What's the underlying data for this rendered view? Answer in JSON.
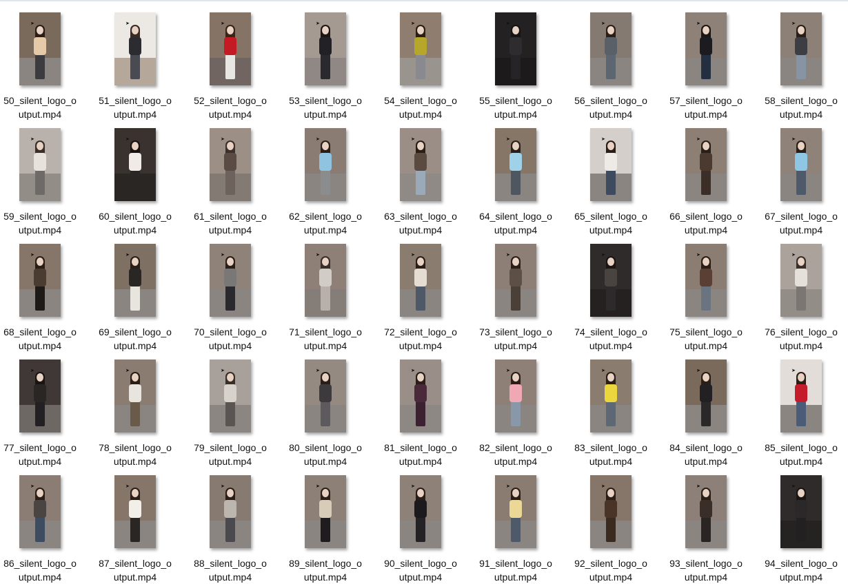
{
  "files": [
    {
      "line1": "50_silent_logo_o",
      "line2": "utput.mp4",
      "wall": "#7a6a5c",
      "floor": "#8a8580",
      "top": "#e6c9a6",
      "legs": "#3c3c40",
      "hair": "#2a1d18"
    },
    {
      "line1": "51_silent_logo_o",
      "line2": "utput.mp4",
      "wall": "#ece8e4",
      "floor": "#b5a89a",
      "top": "#2c2c30",
      "legs": "#4a4a52",
      "hair": "#3a2a22"
    },
    {
      "line1": "52_silent_logo_o",
      "line2": "utput.mp4",
      "wall": "#857466",
      "floor": "#706560",
      "top": "#c41a24",
      "legs": "#e8e6e2",
      "hair": "#3a2418"
    },
    {
      "line1": "53_silent_logo_o",
      "line2": "utput.mp4",
      "wall": "#a59a92",
      "floor": "#8f8884",
      "top": "#222226",
      "legs": "#2a2a2e",
      "hair": "#1e1612"
    },
    {
      "line1": "54_silent_logo_o",
      "line2": "utput.mp4",
      "wall": "#8f7e70",
      "floor": "#9a948e",
      "top": "#b6a62a",
      "legs": "#888a90",
      "hair": "#2a1e16"
    },
    {
      "line1": "55_silent_logo_o",
      "line2": "utput.mp4",
      "wall": "#232122",
      "floor": "#1c1a1b",
      "top": "#2e2c2e",
      "legs": "#262426",
      "hair": "#151314"
    },
    {
      "line1": "56_silent_logo_o",
      "line2": "utput.mp4",
      "wall": "#857a72",
      "floor": "#8a8580",
      "top": "#596068",
      "legs": "#5c6670",
      "hair": "#2a1e16"
    },
    {
      "line1": "57_silent_logo_o",
      "line2": "utput.mp4",
      "wall": "#8e8178",
      "floor": "#8a8580",
      "top": "#1c1c20",
      "legs": "#243042",
      "hair": "#1e1612"
    },
    {
      "line1": "58_silent_logo_o",
      "line2": "utput.mp4",
      "wall": "#8d8076",
      "floor": "#8a8580",
      "top": "#3c3e44",
      "legs": "#8694a4",
      "hair": "#2a1e16"
    },
    {
      "line1": "59_silent_logo_o",
      "line2": "utput.mp4",
      "wall": "#b9b2ac",
      "floor": "#938d88",
      "top": "#e8e2dc",
      "legs": "#6e6a68",
      "hair": "#3a2e28"
    },
    {
      "line1": "60_silent_logo_o",
      "line2": "utput.mp4",
      "wall": "#39322f",
      "floor": "#2a2624",
      "top": "#f0ebe6",
      "legs": "#2a2624",
      "hair": "#1a1210"
    },
    {
      "line1": "61_silent_logo_o",
      "line2": "utput.mp4",
      "wall": "#9b8f86",
      "floor": "#847a74",
      "top": "#5a4c44",
      "legs": "#6e625c",
      "hair": "#3c302a"
    },
    {
      "line1": "62_silent_logo_o",
      "line2": "utput.mp4",
      "wall": "#8a7c72",
      "floor": "#8a8580",
      "top": "#8fc3e0",
      "legs": "#8a8c8e",
      "hair": "#2a1e16"
    },
    {
      "line1": "63_silent_logo_o",
      "line2": "utput.mp4",
      "wall": "#9a8e86",
      "floor": "#8f8a86",
      "top": "#5a4a40",
      "legs": "#9aaab8",
      "hair": "#2a1e16"
    },
    {
      "line1": "64_silent_logo_o",
      "line2": "utput.mp4",
      "wall": "#857668",
      "floor": "#8a8580",
      "top": "#9fd1e8",
      "legs": "#4e5660",
      "hair": "#2a1e16"
    },
    {
      "line1": "65_silent_logo_o",
      "line2": "utput.mp4",
      "wall": "#d4cfca",
      "floor": "#8a8580",
      "top": "#eeeae6",
      "legs": "#3e4a5e",
      "hair": "#2a1e16"
    },
    {
      "line1": "66_silent_logo_o",
      "line2": "utput.mp4",
      "wall": "#8d7f74",
      "floor": "#8a8580",
      "top": "#4a3a30",
      "legs": "#3a2e26",
      "hair": "#2a1e16"
    },
    {
      "line1": "67_silent_logo_o",
      "line2": "utput.mp4",
      "wall": "#8f8279",
      "floor": "#8a8580",
      "top": "#8fc6e4",
      "legs": "#4e5a6a",
      "hair": "#2a1e16"
    },
    {
      "line1": "68_silent_logo_o",
      "line2": "utput.mp4",
      "wall": "#857669",
      "floor": "#8a8580",
      "top": "#4b3c32",
      "legs": "#1e1a18",
      "hair": "#2a1e16"
    },
    {
      "line1": "69_silent_logo_o",
      "line2": "utput.mp4",
      "wall": "#7f7064",
      "floor": "#8a8580",
      "top": "#2a2624",
      "legs": "#e8e4de",
      "hair": "#2a1e16"
    },
    {
      "line1": "70_silent_logo_o",
      "line2": "utput.mp4",
      "wall": "#8f8279",
      "floor": "#8a8580",
      "top": "#7a7876",
      "legs": "#2a2a2e",
      "hair": "#2a1e16"
    },
    {
      "line1": "71_silent_logo_o",
      "line2": "utput.mp4",
      "wall": "#8e8077",
      "floor": "#857d78",
      "top": "#d2ccc6",
      "legs": "#b8b0aa",
      "hair": "#3a2e28"
    },
    {
      "line1": "72_silent_logo_o",
      "line2": "utput.mp4",
      "wall": "#8b7c70",
      "floor": "#8a8580",
      "top": "#e6ddd2",
      "legs": "#4e5866",
      "hair": "#2a1e16"
    },
    {
      "line1": "73_silent_logo_o",
      "line2": "utput.mp4",
      "wall": "#8d7f76",
      "floor": "#8a8580",
      "top": "#5c5046",
      "legs": "#4a4038",
      "hair": "#2a1e16"
    },
    {
      "line1": "74_silent_logo_o",
      "line2": "utput.mp4",
      "wall": "#2e2b2a",
      "floor": "#242120",
      "top": "#4a4440",
      "legs": "#2c2a2a",
      "hair": "#1a1412"
    },
    {
      "line1": "75_silent_logo_o",
      "line2": "utput.mp4",
      "wall": "#8c7d72",
      "floor": "#8a8580",
      "top": "#5a4034",
      "legs": "#6a7480",
      "hair": "#2a1e16"
    },
    {
      "line1": "76_silent_logo_o",
      "line2": "utput.mp4",
      "wall": "#aba29b",
      "floor": "#938d88",
      "top": "#e6e0da",
      "legs": "#7c7672",
      "hair": "#3a2e28"
    },
    {
      "line1": "77_silent_logo_o",
      "line2": "utput.mp4",
      "wall": "#3f3836",
      "floor": "#6e6864",
      "top": "#2a2624",
      "legs": "#222022",
      "hair": "#1a1412"
    },
    {
      "line1": "78_silent_logo_o",
      "line2": "utput.mp4",
      "wall": "#8a7c70",
      "floor": "#8a8580",
      "top": "#e8e4de",
      "legs": "#6a5a4a",
      "hair": "#2a1e16"
    },
    {
      "line1": "79_silent_logo_o",
      "line2": "utput.mp4",
      "wall": "#a8a09a",
      "floor": "#8c8682",
      "top": "#d8d2cc",
      "legs": "#5a5452",
      "hair": "#3a2e28"
    },
    {
      "line1": "80_silent_logo_o",
      "line2": "utput.mp4",
      "wall": "#958a82",
      "floor": "#8a8580",
      "top": "#3c3a3c",
      "legs": "#5c5a5c",
      "hair": "#2a1e16"
    },
    {
      "line1": "81_silent_logo_o",
      "line2": "utput.mp4",
      "wall": "#9a8f88",
      "floor": "#8d8884",
      "top": "#4a2a3a",
      "legs": "#3c2230",
      "hair": "#2a1e16"
    },
    {
      "line1": "82_silent_logo_o",
      "line2": "utput.mp4",
      "wall": "#8e8076",
      "floor": "#8a8580",
      "top": "#f0a8b4",
      "legs": "#8898a8",
      "hair": "#2a1e16"
    },
    {
      "line1": "83_silent_logo_o",
      "line2": "utput.mp4",
      "wall": "#8b7c70",
      "floor": "#8a8580",
      "top": "#ecd63e",
      "legs": "#5e6874",
      "hair": "#2a1e16"
    },
    {
      "line1": "84_silent_logo_o",
      "line2": "utput.mp4",
      "wall": "#7a6a5c",
      "floor": "#8a8580",
      "top": "#222022",
      "legs": "#2a2828",
      "hair": "#2a1e16"
    },
    {
      "line1": "85_silent_logo_o",
      "line2": "utput.mp4",
      "wall": "#e2ddd8",
      "floor": "#8a8580",
      "top": "#c41c2a",
      "legs": "#4a5c78",
      "hair": "#2a1e16"
    },
    {
      "line1": "86_silent_logo_o",
      "line2": "utput.mp4",
      "wall": "#8b7d73",
      "floor": "#8a8580",
      "top": "#4a4442",
      "legs": "#3e4c62",
      "hair": "#2a1e16"
    },
    {
      "line1": "87_silent_logo_o",
      "line2": "utput.mp4",
      "wall": "#857669",
      "floor": "#8a8580",
      "top": "#f2eee8",
      "legs": "#2a2624",
      "hair": "#2a1e16"
    },
    {
      "line1": "88_silent_logo_o",
      "line2": "utput.mp4",
      "wall": "#877a70",
      "floor": "#8a8580",
      "top": "#bcb6ae",
      "legs": "#4a4a4e",
      "hair": "#2a1e16"
    },
    {
      "line1": "89_silent_logo_o",
      "line2": "utput.mp4",
      "wall": "#8d8076",
      "floor": "#8a8580",
      "top": "#d6ccb8",
      "legs": "#1e1c1e",
      "hair": "#2a1e16"
    },
    {
      "line1": "90_silent_logo_o",
      "line2": "utput.mp4",
      "wall": "#8e8178",
      "floor": "#8a8580",
      "top": "#1c1a1c",
      "legs": "#242224",
      "hair": "#2a1e16"
    },
    {
      "line1": "91_silent_logo_o",
      "line2": "utput.mp4",
      "wall": "#8a7c70",
      "floor": "#8a8580",
      "top": "#ecd896",
      "legs": "#4e5a6a",
      "hair": "#2a1e16"
    },
    {
      "line1": "92_silent_logo_o",
      "line2": "utput.mp4",
      "wall": "#857669",
      "floor": "#8a8580",
      "top": "#4a3428",
      "legs": "#3a2a20",
      "hair": "#2a1e16"
    },
    {
      "line1": "93_silent_logo_o",
      "line2": "utput.mp4",
      "wall": "#8d8078",
      "floor": "#8a8580",
      "top": "#3a2e28",
      "legs": "#2a2422",
      "hair": "#2a1e16"
    },
    {
      "line1": "94_silent_logo_o",
      "line2": "utput.mp4",
      "wall": "#2e2b2a",
      "floor": "#252222",
      "top": "#2a2828",
      "legs": "#222020",
      "hair": "#1a1412"
    }
  ]
}
